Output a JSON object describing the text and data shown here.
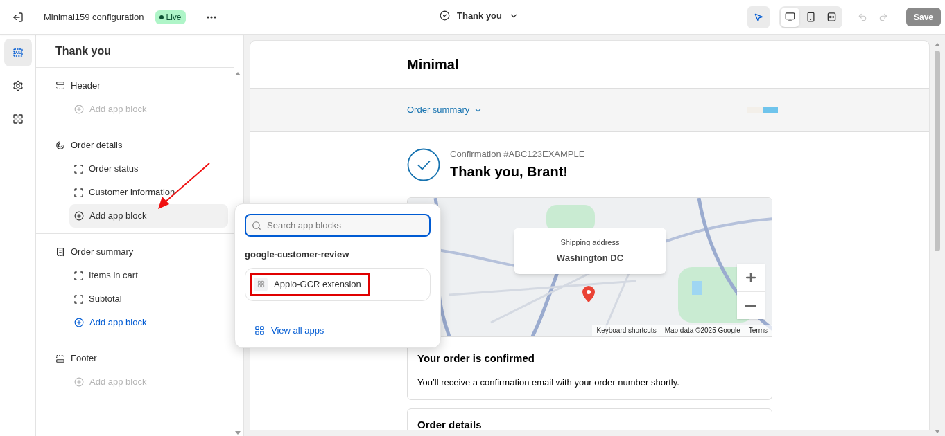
{
  "topbar": {
    "title": "Minimal159 configuration",
    "status": "Live",
    "page": "Thank you",
    "save": "Save",
    "inspector_on": true,
    "views": [
      {
        "kind": "desktop",
        "selected": true
      },
      {
        "kind": "mobile",
        "selected": false
      },
      {
        "kind": "fullwidth",
        "selected": false
      }
    ]
  },
  "rail": [
    {
      "kind": "sections",
      "selected": true
    },
    {
      "kind": "settings",
      "selected": false
    },
    {
      "kind": "apps",
      "selected": false
    }
  ],
  "panel": {
    "title": "Thank you",
    "sections": [
      {
        "kind": "header",
        "label": "Header",
        "children": [
          {
            "kind": "add",
            "label": "Add app block",
            "disabled": true,
            "selected": false
          }
        ]
      },
      {
        "kind": "details",
        "label": "Order details",
        "children": [
          {
            "kind": "block",
            "label": "Order status",
            "disabled": false,
            "selected": false
          },
          {
            "kind": "block",
            "label": "Customer information",
            "disabled": false,
            "selected": false
          },
          {
            "kind": "add",
            "label": "Add app block",
            "disabled": false,
            "selected": true
          }
        ]
      },
      {
        "kind": "summary",
        "label": "Order summary",
        "children": [
          {
            "kind": "block",
            "label": "Items in cart",
            "disabled": false,
            "selected": false
          },
          {
            "kind": "block",
            "label": "Subtotal",
            "disabled": false,
            "selected": false
          },
          {
            "kind": "add",
            "label": "Add app block",
            "disabled": false,
            "selected": false
          }
        ]
      },
      {
        "kind": "footer",
        "label": "Footer",
        "children": [
          {
            "kind": "add",
            "label": "Add app block",
            "disabled": true,
            "selected": false
          }
        ]
      }
    ]
  },
  "popover": {
    "placeholder": "Search app blocks",
    "group": "google-customer-review",
    "apps": [
      {
        "label": "Appio-GCR extension",
        "highlighted": true
      }
    ],
    "link": "View all apps"
  },
  "preview": {
    "store": "Minimal",
    "summary_toggle": "Order summary",
    "confirmation": "Confirmation #ABC123EXAMPLE",
    "greeting": "Thank you, Brant!",
    "map": {
      "card_label": "Shipping address",
      "card_value": "Washington DC",
      "attribution": [
        "Keyboard shortcuts",
        "Map data ©2025 Google",
        "Terms"
      ]
    },
    "cards": [
      {
        "title": "Your order is confirmed",
        "body": "You’ll receive a confirmation email with your order number shortly."
      },
      {
        "title": "Order details"
      }
    ]
  }
}
